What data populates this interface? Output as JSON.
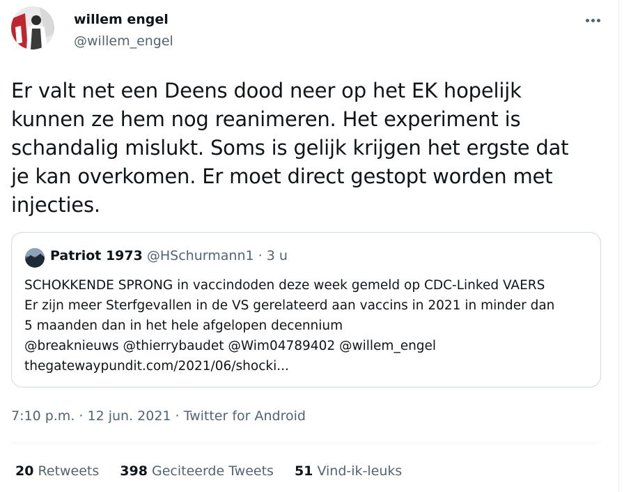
{
  "author": {
    "display_name": "willem engel",
    "handle": "@willem_engel"
  },
  "tweet": {
    "text": "Er valt net een Deens dood neer op het EK hopelijk\nkunnen ze hem nog reanimeren. Het experiment is\nschandalig mislukt. Soms is gelijk krijgen het ergste dat\nje kan overkomen. Er moet direct gestopt worden met\ninjecties."
  },
  "quote": {
    "display_name": "Patriot 1973",
    "handle": "@HSchurmann1",
    "separator": " · ",
    "time": "3 u",
    "text": "SCHOKKENDE SPRONG in vaccindoden deze week gemeld op CDC-Linked VAERS\nEr zijn meer Sterfgevallen in de VS gerelateerd aan vaccins in 2021 in minder dan\n5 maanden dan in het hele afgelopen decennium\n@breaknieuws @thierrybaudet @Wim04789402 @willem_engel\nthegatewaypundit.com/2021/06/shocki..."
  },
  "meta": {
    "time": "7:10 p.m.",
    "separator": " · ",
    "date": "12 jun. 2021",
    "source": "Twitter for Android"
  },
  "stats": {
    "retweets_count": "20",
    "retweets_label": "Retweets",
    "quotes_count": "398",
    "quotes_label": "Geciteerde Tweets",
    "likes_count": "51",
    "likes_label": "Vind-ik-leuks"
  },
  "colors": {
    "text_primary": "#0f1419",
    "text_secondary": "#536471",
    "border": "#cfd9de",
    "divider": "#eff3f4"
  },
  "icons": {
    "more": "more-horizontal-icon"
  }
}
